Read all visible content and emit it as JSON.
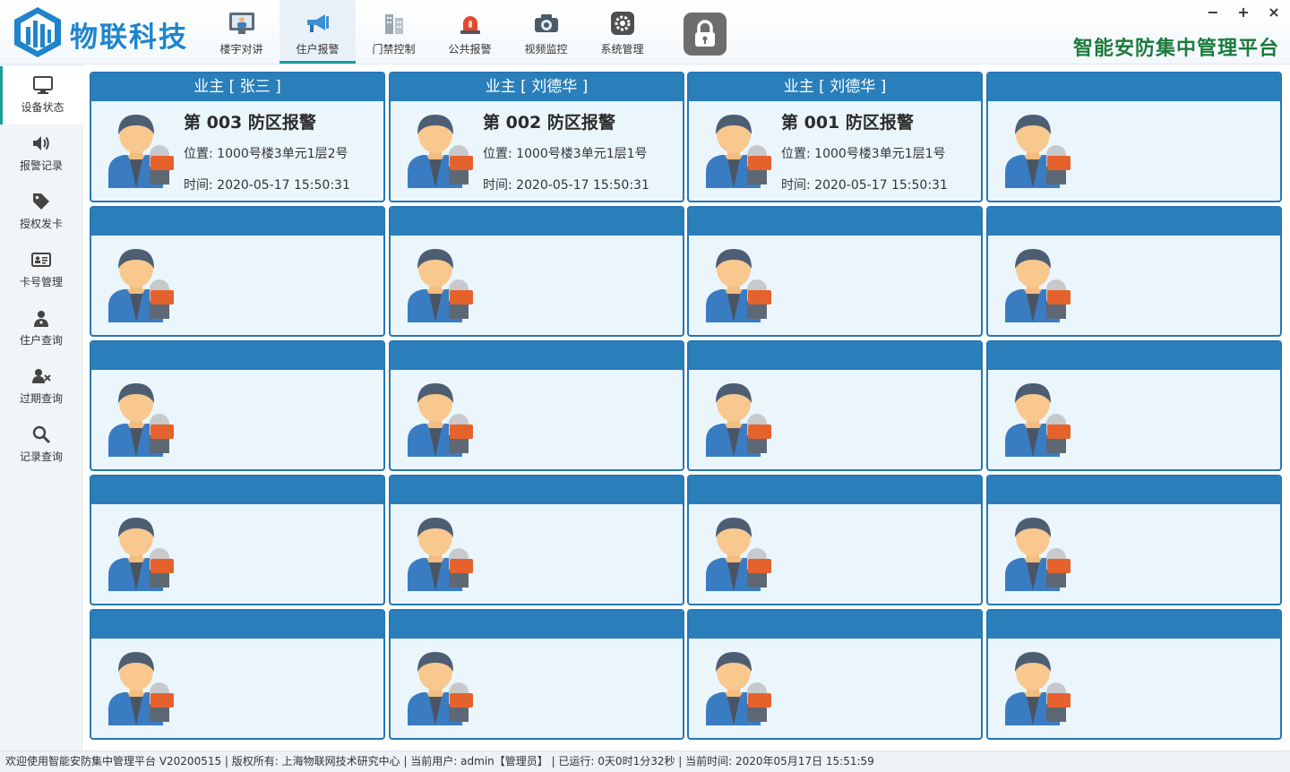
{
  "app": {
    "brand": "物联科技",
    "platform_title": "智能安防集中管理平台",
    "window_controls": {
      "minimize": "−",
      "maximize": "+",
      "close": "×"
    }
  },
  "nav": [
    {
      "label": "楼宇对讲",
      "icon": "monitor-person-icon",
      "active": false
    },
    {
      "label": "住户报警",
      "icon": "megaphone-icon",
      "active": true
    },
    {
      "label": "门禁控制",
      "icon": "building-icon",
      "active": false
    },
    {
      "label": "公共报警",
      "icon": "siren-icon",
      "active": false
    },
    {
      "label": "视频监控",
      "icon": "camera-icon",
      "active": false
    },
    {
      "label": "系统管理",
      "icon": "gear-icon",
      "active": false
    }
  ],
  "sidebar": [
    {
      "label": "设备状态",
      "icon": "monitor-icon",
      "active": true
    },
    {
      "label": "报警记录",
      "icon": "speaker-icon",
      "active": false
    },
    {
      "label": "授权发卡",
      "icon": "tag-icon",
      "active": false
    },
    {
      "label": "卡号管理",
      "icon": "id-card-icon",
      "active": false
    },
    {
      "label": "住户查询",
      "icon": "person-icon",
      "active": false
    },
    {
      "label": "过期查询",
      "icon": "user-remove-icon",
      "active": false
    },
    {
      "label": "记录查询",
      "icon": "search-icon",
      "active": false
    }
  ],
  "cards": [
    {
      "head": "业主 [ 张三 ]",
      "title": "第 003 防区报警",
      "location": "位置: 1000号楼3单元1层2号",
      "time": "时间: 2020-05-17 15:50:31"
    },
    {
      "head": "业主 [ 刘德华 ]",
      "title": "第 002 防区报警",
      "location": "位置: 1000号楼3单元1层1号",
      "time": "时间: 2020-05-17 15:50:31"
    },
    {
      "head": "业主 [ 刘德华 ]",
      "title": "第 001 防区报警",
      "location": "位置: 1000号楼3单元1层1号",
      "time": "时间: 2020-05-17 15:50:31"
    },
    {
      "head": "",
      "title": "",
      "location": "",
      "time": ""
    },
    {
      "head": "",
      "title": "",
      "location": "",
      "time": ""
    },
    {
      "head": "",
      "title": "",
      "location": "",
      "time": ""
    },
    {
      "head": "",
      "title": "",
      "location": "",
      "time": ""
    },
    {
      "head": "",
      "title": "",
      "location": "",
      "time": ""
    },
    {
      "head": "",
      "title": "",
      "location": "",
      "time": ""
    },
    {
      "head": "",
      "title": "",
      "location": "",
      "time": ""
    },
    {
      "head": "",
      "title": "",
      "location": "",
      "time": ""
    },
    {
      "head": "",
      "title": "",
      "location": "",
      "time": ""
    },
    {
      "head": "",
      "title": "",
      "location": "",
      "time": ""
    },
    {
      "head": "",
      "title": "",
      "location": "",
      "time": ""
    },
    {
      "head": "",
      "title": "",
      "location": "",
      "time": ""
    },
    {
      "head": "",
      "title": "",
      "location": "",
      "time": ""
    },
    {
      "head": "",
      "title": "",
      "location": "",
      "time": ""
    },
    {
      "head": "",
      "title": "",
      "location": "",
      "time": ""
    },
    {
      "head": "",
      "title": "",
      "location": "",
      "time": ""
    },
    {
      "head": "",
      "title": "",
      "location": "",
      "time": ""
    }
  ],
  "status": {
    "text": "欢迎使用智能安防集中管理平台 V20200515 | 版权所有: 上海物联网技术研究中心 | 当前用户: admin【管理员】 | 已运行: 0天0时1分32秒 | 当前时间: 2020年05月17日 15:51:59"
  },
  "colors": {
    "accent": "#2a7fba",
    "card_bg": "#eaf6fc",
    "brand": "#1f84cc",
    "platform": "#1b7a3c",
    "tab_indicator": "#1a9d9d"
  }
}
